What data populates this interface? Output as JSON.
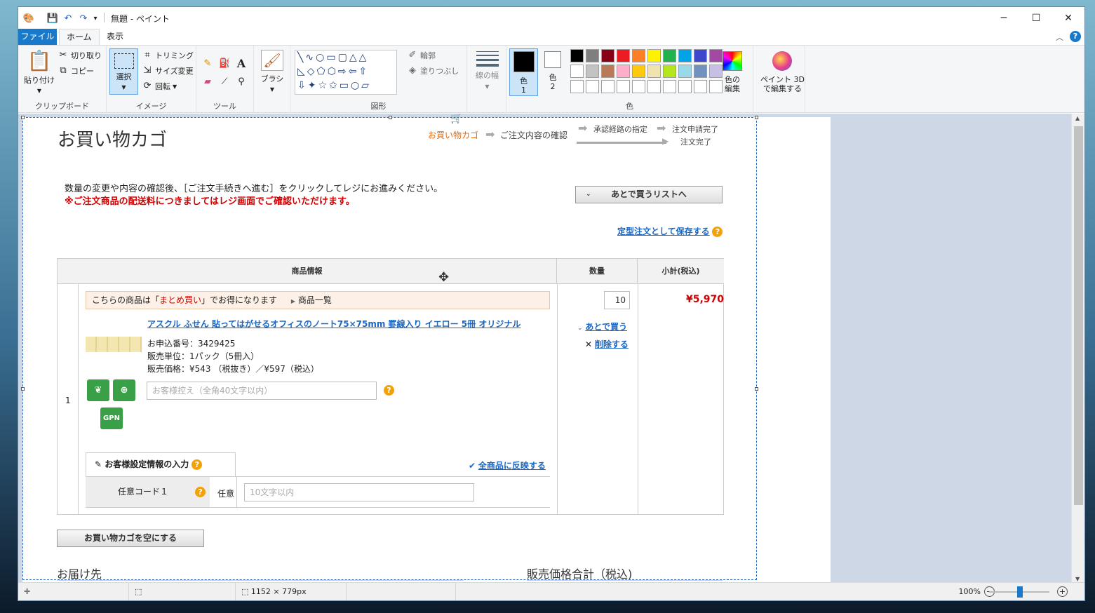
{
  "window": {
    "title": "無題 - ペイント",
    "qat_more": "▾"
  },
  "tabs": {
    "file": "ファイル",
    "home": "ホーム",
    "view": "表示"
  },
  "ribbon": {
    "clipboard": {
      "paste": "貼り付け",
      "cut": "切り取り",
      "copy": "コピー",
      "label": "クリップボード"
    },
    "image": {
      "select": "選択",
      "crop": "トリミング",
      "resize": "サイズ変更",
      "rotate": "回転",
      "label": "イメージ"
    },
    "tools": {
      "label": "ツール"
    },
    "brush": {
      "label": "ブラシ"
    },
    "shapes": {
      "label": "図形",
      "outline": "輪郭",
      "fill": "塗りつぶし"
    },
    "size": {
      "label": "線の幅"
    },
    "colors": {
      "color1": "色\n1",
      "color2": "色\n2",
      "edit": "色の\n編集",
      "label": "色",
      "paint3d": "ペイント 3D\nで編集する"
    },
    "palette": [
      "#000000",
      "#7f7f7f",
      "#880015",
      "#ed1c24",
      "#ff7f27",
      "#fff200",
      "#22b14c",
      "#00a2e8",
      "#3f48cc",
      "#a349a4",
      "#ffffff",
      "#c3c3c3",
      "#b97a57",
      "#ffaec9",
      "#ffc90e",
      "#efe4b0",
      "#b5e61d",
      "#99d9ea",
      "#7092be",
      "#c8bfe7"
    ]
  },
  "page": {
    "title": "お買い物カゴ",
    "steps": {
      "s1": "お買い物カゴ",
      "s2": "ご注文内容の確認",
      "s3": "承認経路の指定",
      "s4": "注文申請完了",
      "s5": "注文完了"
    },
    "msg1": "数量の変更や内容の確認後、［ご注文手続きへ進む］をクリックしてレジにお進みください。",
    "msg2": "※ご注文商品の配送料につきましてはレジ画面でご確認いただけます。",
    "later_list": "あとで買うリストへ",
    "save_fixed": "定型注文として保存する",
    "th_product": "商品情報",
    "th_qty": "数量",
    "th_subtotal": "小計(税込)",
    "row_no": "1",
    "bulk_prefix": "こちらの商品は「",
    "bulk_em": "まとめ買い",
    "bulk_suffix": "」でお得になります",
    "product_list": "商品一覧",
    "product_name": "アスクル ふせん 貼ってはがせるオフィスのノート75×75mm 罫線入り イエロー 5冊 オリジナル",
    "order_no": "お申込番号：3429425",
    "unit": "販売単位：1パック（5冊入）",
    "price": "販売価格：¥543 （税抜き）／¥597（税込）",
    "memo_placeholder": "お客様控え（全角40文字以内）",
    "gpn": "GPN",
    "qty": "10",
    "subtotal": "¥5,970",
    "buy_later": "あとで買う",
    "delete": "削除する",
    "settings_tab": "お客様設定情報の入力",
    "apply_all": "全商品に反映する",
    "code1": "任意コード１",
    "optional": "任意",
    "code_placeholder": "10文字以内",
    "empty_cart": "お買い物カゴを空にする",
    "delivery": "お届け先",
    "total_label": "販売価格合計（税込)"
  },
  "status": {
    "dimensions": "1152 × 779px",
    "zoom": "100%"
  }
}
